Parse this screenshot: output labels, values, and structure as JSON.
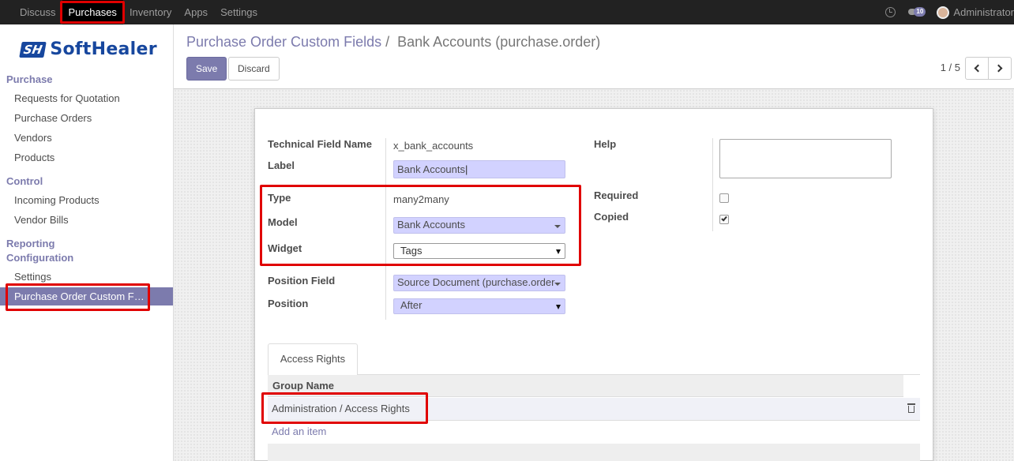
{
  "topnav": {
    "items": [
      "Discuss",
      "Purchases",
      "Inventory",
      "Apps",
      "Settings"
    ],
    "active": "Purchases",
    "message_count": "10",
    "user_name": "Administrator"
  },
  "sidebar": {
    "logo_mark": "SH",
    "logo_text": "SoftHealer",
    "sections": [
      {
        "title": "Purchase",
        "items": [
          "Requests for Quotation",
          "Purchase Orders",
          "Vendors",
          "Products"
        ]
      },
      {
        "title": "Control",
        "items": [
          "Incoming Products",
          "Vendor Bills"
        ]
      },
      {
        "title": "Reporting",
        "items": []
      },
      {
        "title": "Configuration",
        "items": [
          "Settings",
          "Purchase Order Custom F…"
        ]
      }
    ],
    "active_item": "Purchase Order Custom F…"
  },
  "header": {
    "breadcrumb_parent": "Purchase Order Custom Fields",
    "breadcrumb_sep": "/",
    "breadcrumb_current": "Bank Accounts (purchase.order)",
    "save_label": "Save",
    "discard_label": "Discard",
    "pager": "1 / 5"
  },
  "form": {
    "technical_field_name_label": "Technical Field Name",
    "technical_field_name_value": "x_bank_accounts",
    "label_label": "Label",
    "label_value": "Bank Accounts",
    "type_label": "Type",
    "type_value": "many2many",
    "model_label": "Model",
    "model_value": "Bank Accounts",
    "widget_label": "Widget",
    "widget_value": "Tags",
    "position_field_label": "Position Field",
    "position_field_value": "Source Document (purchase.order",
    "position_label": "Position",
    "position_value": "After",
    "help_label": "Help",
    "help_value": "",
    "required_label": "Required",
    "required_checked": false,
    "copied_label": "Copied",
    "copied_checked": true
  },
  "tabs": {
    "active": "Access Rights",
    "table": {
      "columns": [
        "Group Name"
      ],
      "rows": [
        [
          "Administration / Access Rights"
        ]
      ],
      "add_item": "Add an item"
    }
  },
  "colors": {
    "brand": "#7c7bad",
    "topbar": "#222222",
    "highlight": "#e00000",
    "input_fill": "#d2d2ff"
  }
}
